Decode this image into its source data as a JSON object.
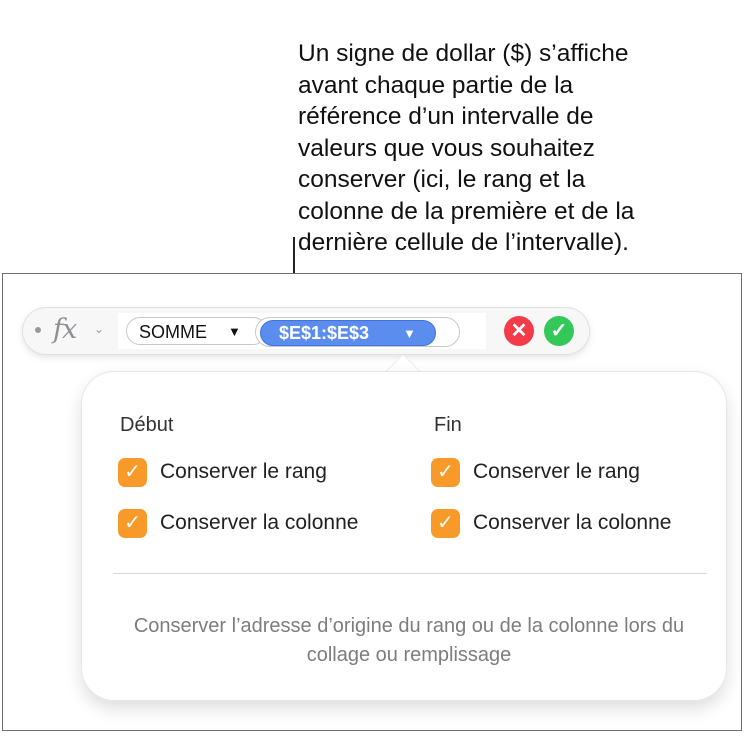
{
  "callout": {
    "text": "Un signe de dollar ($) s’affiche\navant chaque partie de la\nréférence d’un intervalle de\nvaleurs que vous souhaitez\nconserver (ici, le rang et la\ncolonne de la première et de la\ndernière cellule de l’intervalle)."
  },
  "formula_bar": {
    "fx_label": "fx",
    "fx_chevron": "⌄",
    "function_token": {
      "label": "SOMME",
      "arrow": "▼"
    },
    "range_token": {
      "label": "$E$1:$E$3",
      "arrow": "▼"
    },
    "cancel_symbol": "✕",
    "accept_symbol": "✓",
    "colors": {
      "range_token": "#5b8def",
      "cancel": "#f23c4a",
      "accept": "#34c759"
    }
  },
  "popover": {
    "start_section": {
      "title": "Début",
      "options": [
        {
          "label": "Conserver le rang",
          "checked": true
        },
        {
          "label": "Conserver la colonne",
          "checked": true
        }
      ]
    },
    "end_section": {
      "title": "Fin",
      "options": [
        {
          "label": "Conserver le rang",
          "checked": true
        },
        {
          "label": "Conserver la colonne",
          "checked": true
        }
      ]
    },
    "check_mark": "✓",
    "checkbox_color": "#f89a2a",
    "help_text": "Conserver l’adresse d’origine du rang ou de la colonne lors du collage ou remplissage"
  }
}
